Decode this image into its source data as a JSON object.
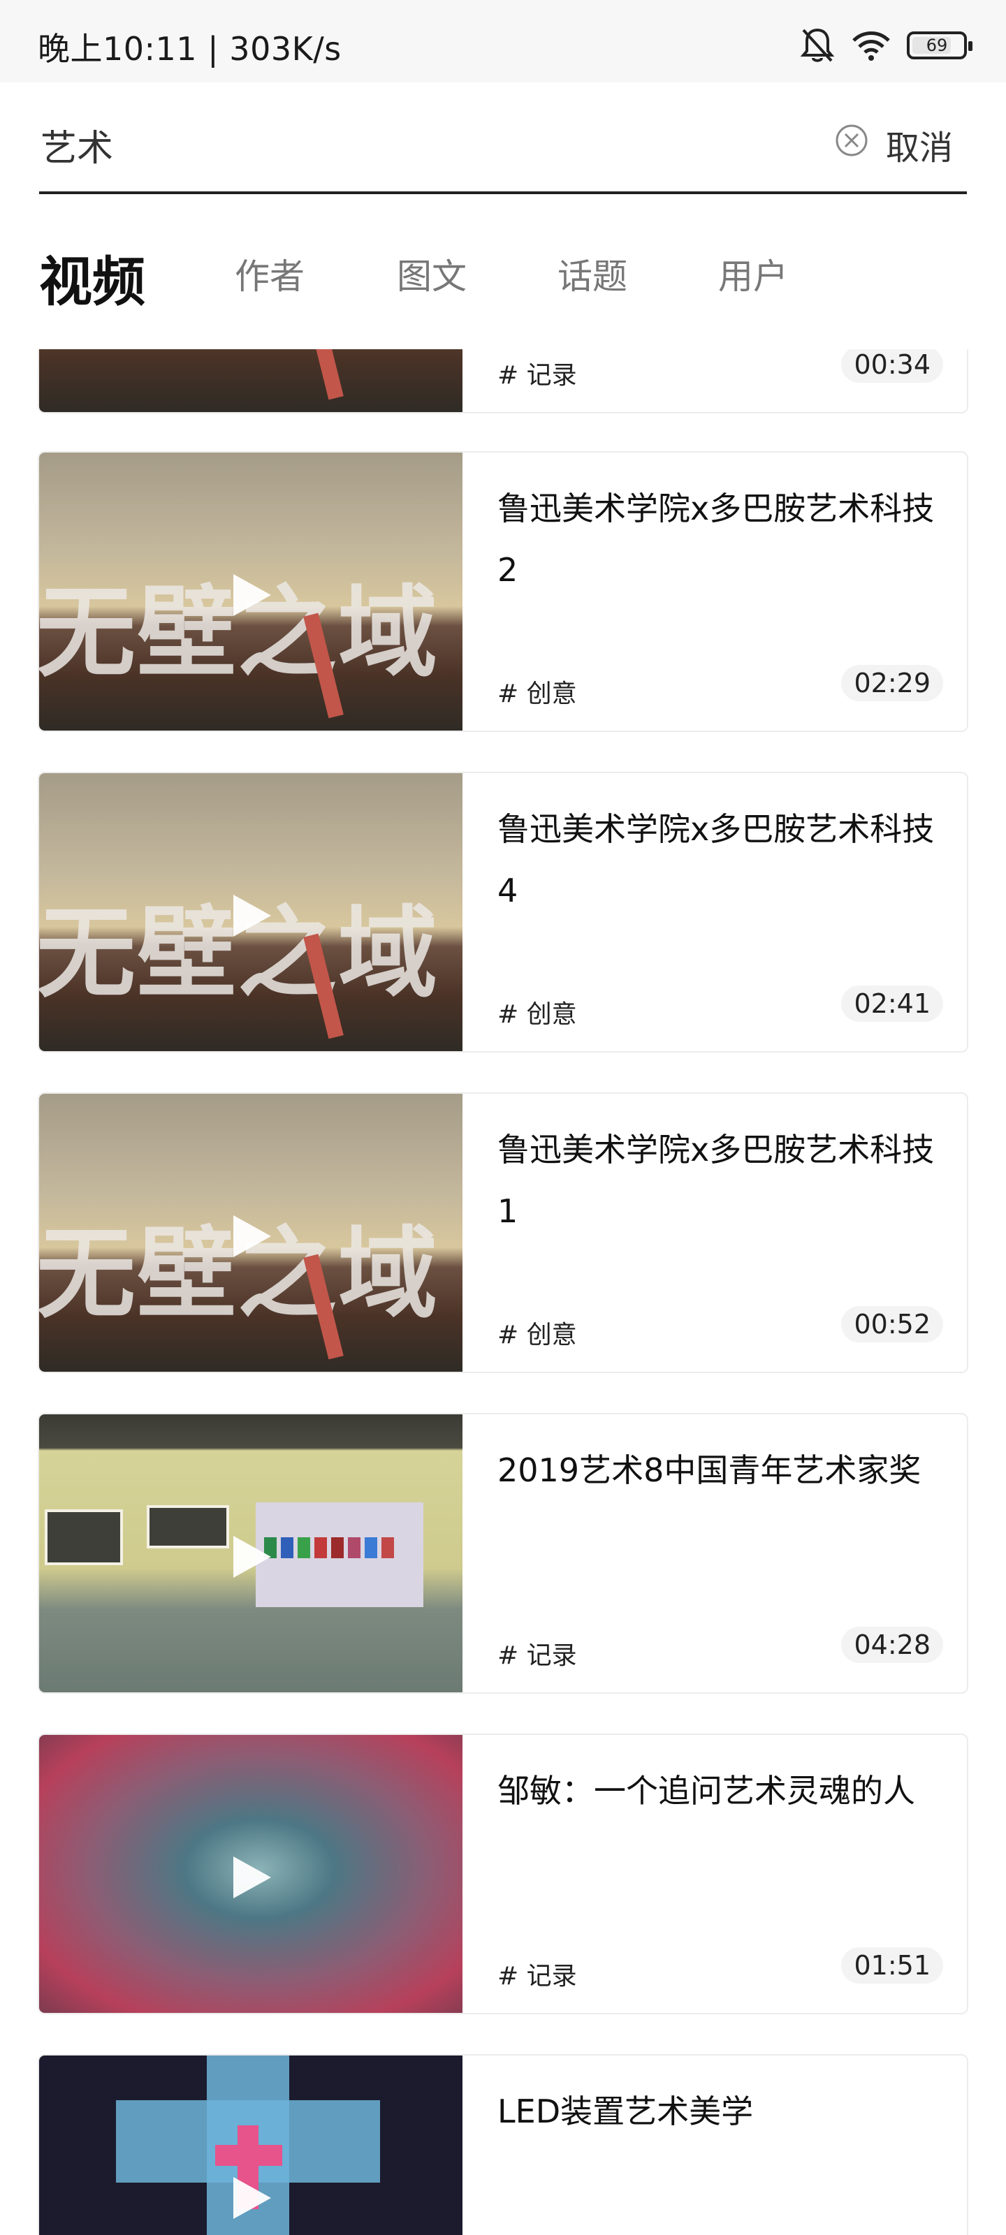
{
  "status_bar": {
    "time_speed": "晚上10:11 | 303K/s",
    "battery": "69",
    "icons": [
      "bell-muted-icon",
      "wifi-icon",
      "battery-icon"
    ]
  },
  "search": {
    "value": "艺术",
    "clear_icon": "close-circle-icon",
    "cancel_label": "取消"
  },
  "tabs": [
    {
      "label": "视频",
      "active": true
    },
    {
      "label": "作者",
      "active": false
    },
    {
      "label": "图文",
      "active": false
    },
    {
      "label": "话题",
      "active": false
    },
    {
      "label": "用户",
      "active": false
    }
  ],
  "videos": [
    {
      "title": "",
      "tag": "# 记录",
      "duration": "00:34"
    },
    {
      "title": "鲁迅美术学院x多巴胺艺术科技2",
      "tag": "# 创意",
      "duration": "02:29",
      "thumb_text": "无壁之域"
    },
    {
      "title": "鲁迅美术学院x多巴胺艺术科技4",
      "tag": "# 创意",
      "duration": "02:41",
      "thumb_text": "无壁之域"
    },
    {
      "title": "鲁迅美术学院x多巴胺艺术科技1",
      "tag": "# 创意",
      "duration": "00:52",
      "thumb_text": "无壁之域"
    },
    {
      "title": "2019艺术8中国青年艺术家奖",
      "tag": "# 记录",
      "duration": "04:28"
    },
    {
      "title": "邹敏：一个追问艺术灵魂的人",
      "tag": "# 记录",
      "duration": "01:51"
    },
    {
      "title": "LED装置艺术美学",
      "tag": "",
      "duration": ""
    }
  ],
  "colors": {
    "accent": "#111111",
    "tab_inactive": "#777777",
    "card_border": "#ececec",
    "duration_bg": "#f3f3f3"
  }
}
